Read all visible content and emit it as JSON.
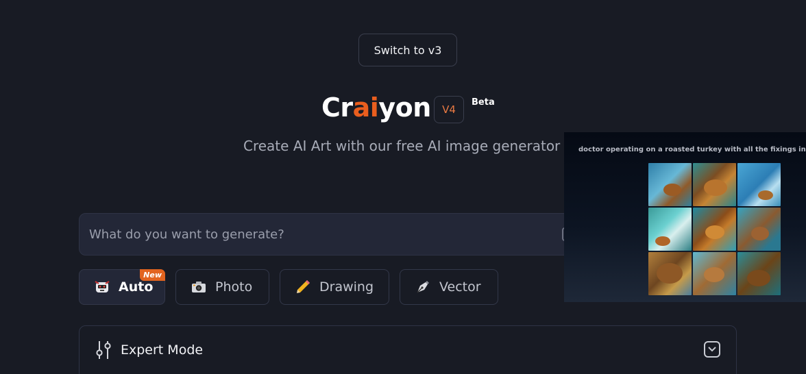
{
  "header": {
    "switch_label": "Switch to v3",
    "logo_parts": [
      "Cr",
      "ai",
      "yon"
    ],
    "version": "V4",
    "beta": "Beta",
    "tagline": "Create AI Art with our free AI image generator"
  },
  "prompt": {
    "placeholder": "What do you want to generate?",
    "value": ""
  },
  "styles": [
    {
      "label": "Auto",
      "icon": "robot-icon",
      "active": true,
      "badge": "New"
    },
    {
      "label": "Photo",
      "icon": "camera-icon",
      "active": false
    },
    {
      "label": "Drawing",
      "icon": "pencil-icon",
      "active": false
    },
    {
      "label": "Vector",
      "icon": "pen-nib-icon",
      "active": false
    }
  ],
  "expert": {
    "label": "Expert Mode",
    "icon": "sliders-icon",
    "toggle_icon": "chevron-down-icon"
  },
  "preview": {
    "caption": "doctor operating on a roasted turkey with all the fixings in the ope",
    "image_count": 9
  },
  "colors": {
    "background": "#181b24",
    "accent": "#ea5e1e",
    "badge": "#e2641f"
  }
}
